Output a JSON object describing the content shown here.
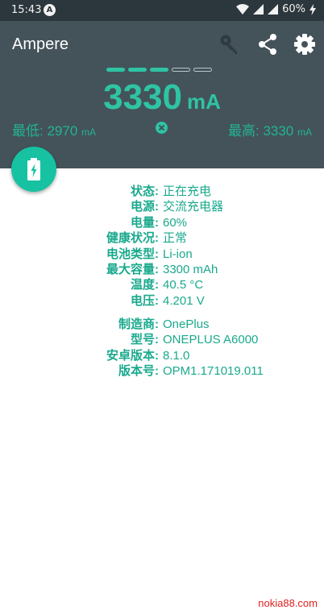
{
  "status_bar": {
    "time": "15:43",
    "notification_icon": "A",
    "battery_percent": "60%",
    "icons": [
      "wifi-icon",
      "signal-icon",
      "signal-icon",
      "battery-charging-icon"
    ]
  },
  "app": {
    "title": "Ampere",
    "toolbar_icons": [
      "key-icon",
      "share-icon",
      "gear-icon"
    ]
  },
  "meter": {
    "current_value": "3330",
    "current_unit": "mA",
    "level_segments_on": 3,
    "level_segments_total": 5,
    "min_label": "最低:",
    "min_value": "2970",
    "min_unit": "mA",
    "max_label": "最高:",
    "max_value": "3330",
    "max_unit": "mA",
    "reset_icon": "close-circle-icon"
  },
  "fab": {
    "icon": "battery-charging-icon"
  },
  "battery_info": [
    {
      "label": "状态:",
      "value": "正在充电"
    },
    {
      "label": "电源:",
      "value": "交流充电器"
    },
    {
      "label": "电量:",
      "value": "60%"
    },
    {
      "label": "健康状况:",
      "value": "正常"
    },
    {
      "label": "电池类型:",
      "value": "Li-ion"
    },
    {
      "label": "最大容量:",
      "value": "3300 mAh"
    },
    {
      "label": "温度:",
      "value": "40.5 °C"
    },
    {
      "label": "电压:",
      "value": "4.201 V"
    }
  ],
  "device_info": [
    {
      "label": "制造商:",
      "value": "OnePlus"
    },
    {
      "label": "型号:",
      "value": "ONEPLUS A6000"
    },
    {
      "label": "安卓版本:",
      "value": "8.1.0"
    },
    {
      "label": "版本号:",
      "value": "OPM1.171019.011"
    }
  ],
  "watermark": "nokia88.com",
  "colors": {
    "header_bg": "#44535a",
    "status_bg": "#2c373d",
    "accent": "#2ec4a4",
    "fab": "#16c2a2",
    "text_accent": "#1aa98d"
  }
}
